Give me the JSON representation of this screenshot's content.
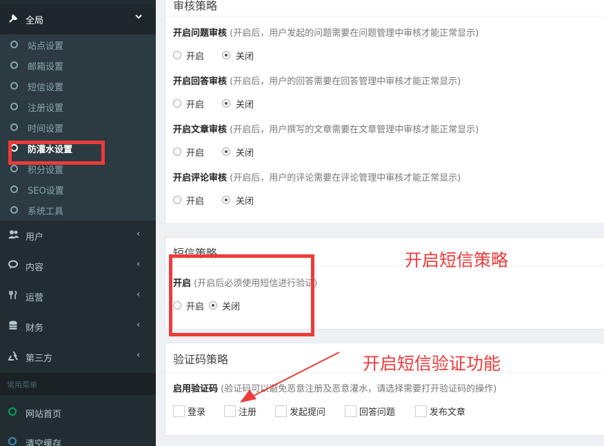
{
  "sidebar": {
    "top": {
      "label": "全局",
      "icon": "wrench-icon"
    },
    "submenu": [
      {
        "label": "站点设置"
      },
      {
        "label": "邮箱设置"
      },
      {
        "label": "短信设置"
      },
      {
        "label": "注册设置"
      },
      {
        "label": "时间设置"
      },
      {
        "label": "防灌水设置",
        "active": true
      },
      {
        "label": "积分设置"
      },
      {
        "label": "SEO设置"
      },
      {
        "label": "系统工具"
      }
    ],
    "menus": [
      {
        "label": "用户",
        "icon": "users-icon"
      },
      {
        "label": "内容",
        "icon": "comments-icon"
      },
      {
        "label": "运营",
        "icon": "cutlery-icon"
      },
      {
        "label": "财务",
        "icon": "database-icon"
      },
      {
        "label": "第三方",
        "icon": "recycle-icon"
      }
    ],
    "section_header": "常用菜单",
    "quick": [
      {
        "label": "网站首页",
        "color": "#00a65a"
      },
      {
        "label": "清空缓存",
        "color": "#3c8dbc"
      }
    ]
  },
  "review": {
    "title": "审核策略",
    "items": [
      {
        "label": "开启问题审核",
        "hint": "(开启后，用户发起的问题需要在问题管理中审核才能正常显示)",
        "on": "开启",
        "off": "关闭"
      },
      {
        "label": "开启回答审核",
        "hint": "(开启后，用户的回答需要在回答管理中审核才能正常显示)",
        "on": "开启",
        "off": "关闭"
      },
      {
        "label": "开启文章审核",
        "hint": "(开启后，用户撰写的文章需要在文章管理中审核才能正常显示)",
        "on": "开启",
        "off": "关闭"
      },
      {
        "label": "开启评论审核",
        "hint": "(开启后，用户的评论需要在评论管理中审核才能正常显示)",
        "on": "开启",
        "off": "关闭"
      }
    ]
  },
  "sms": {
    "title": "短信策略",
    "label": "开启",
    "hint": "(开启后必须使用短信进行验证)",
    "on": "开启",
    "off": "关闭"
  },
  "captcha": {
    "title": "验证码策略",
    "label": "启用验证码",
    "hint": "(验证码可以避免恶意注册及恶意灌水，请选择需要打开验证码的操作)",
    "options": [
      "登录",
      "注册",
      "发起提问",
      "回答问题",
      "发布文章"
    ]
  },
  "annotations": {
    "sms_note": "开启短信策略",
    "captcha_note": "开启短信验证功能",
    "color": "#ef3a3a"
  }
}
